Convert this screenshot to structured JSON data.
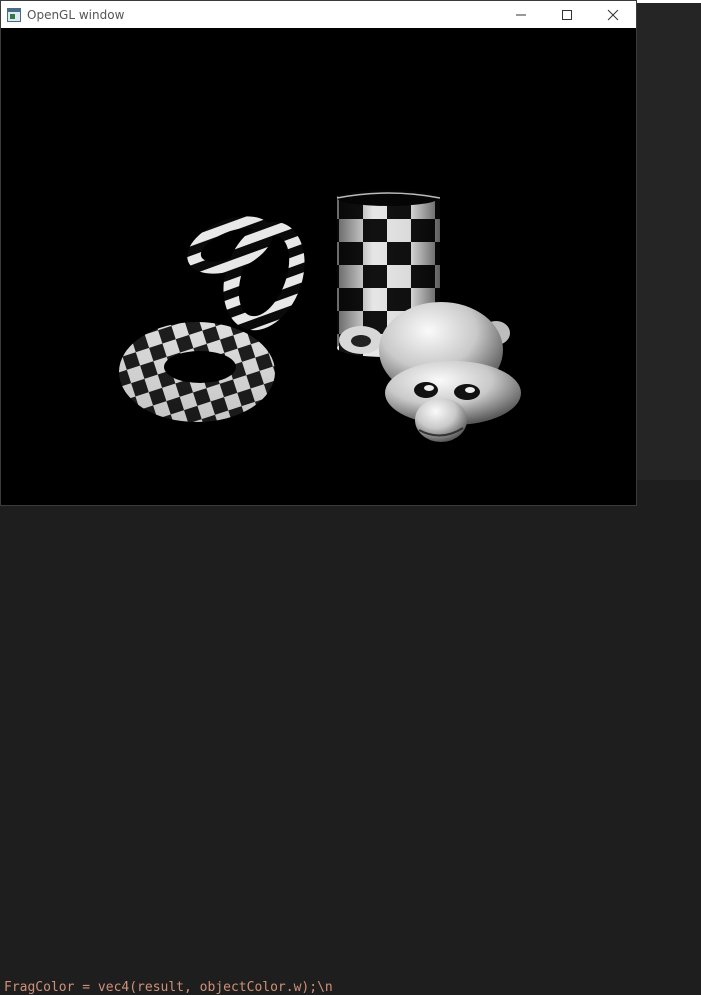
{
  "window": {
    "title": "OpenGL window",
    "controls": {
      "minimize": "minimize-icon",
      "maximize": "maximize-icon",
      "close": "close-icon"
    }
  },
  "scene": {
    "objects": [
      "torus",
      "torus",
      "torus",
      "cylinder",
      "monkey-head"
    ],
    "pattern": "checkerboard",
    "background": "#000000"
  },
  "editor": {
    "code_line": "FragColor = vec4(result, objectColor.w);\\n"
  }
}
